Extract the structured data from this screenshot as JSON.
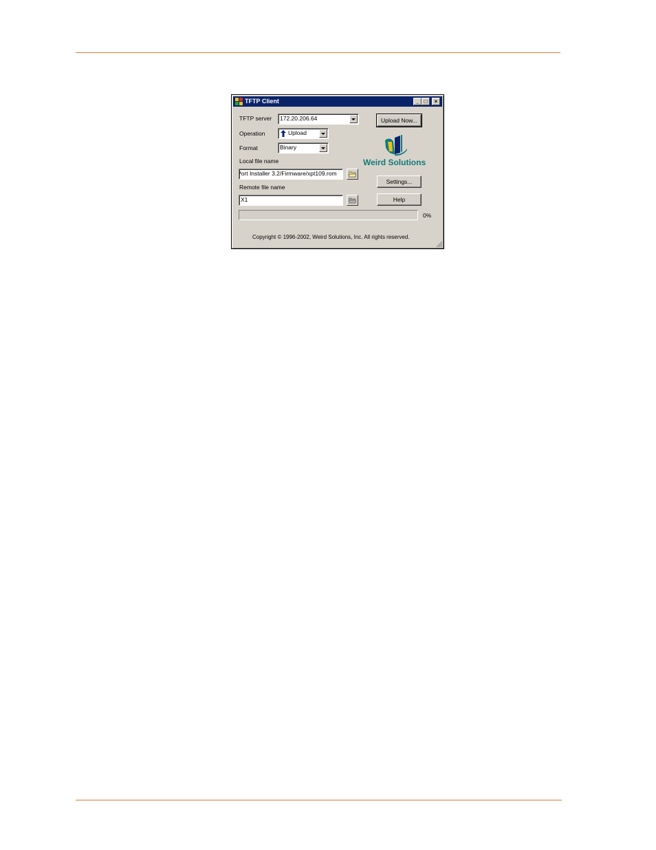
{
  "window": {
    "title": "TFTP Client",
    "minimize_label": "_",
    "maximize_label": "□",
    "close_label": "×"
  },
  "form": {
    "tftp_server_label": "TFTP server",
    "tftp_server_value": "172.20.206.64",
    "operation_label": "Operation",
    "operation_value": "Upload",
    "format_label": "Format",
    "format_value": "Binary",
    "local_file_label": "Local file name",
    "local_file_value": "Port Installer 3.2/Firmware/xpt109.rom",
    "remote_file_label": "Remote file name",
    "remote_file_value": "X1"
  },
  "buttons": {
    "upload_now": "Upload Now...",
    "settings": "Settings...",
    "help": "Help"
  },
  "logo": {
    "text": "Weird Solutions"
  },
  "progress": {
    "percent_label": "0%",
    "value": 0
  },
  "footer": {
    "copyright": "Copyright © 1996-2002, Weird Solutions, Inc. All rights reserved."
  },
  "colors": {
    "titlebar": "#0a246a",
    "dialog_bg": "#d7d3cb",
    "logo_teal": "#127a78",
    "page_rule": "#e07b2e"
  }
}
